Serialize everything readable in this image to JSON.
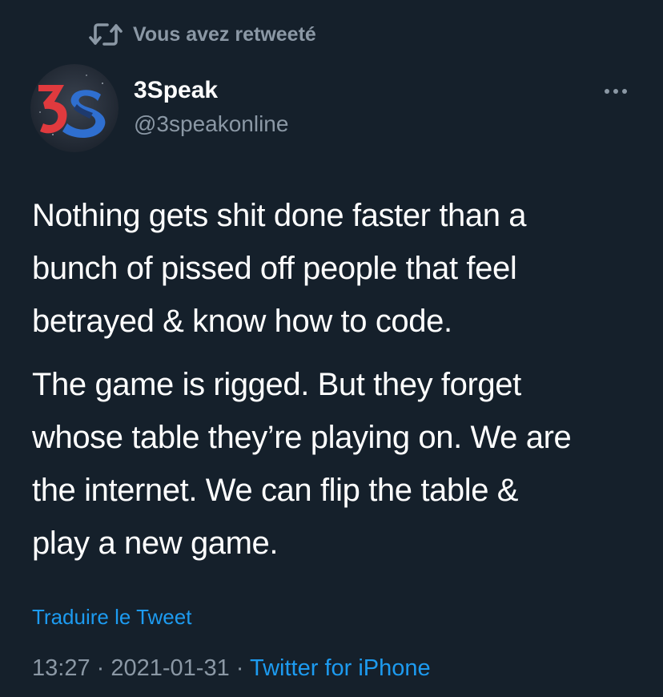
{
  "retweet": {
    "label": "Vous avez retweeté",
    "icon": "retweet-icon"
  },
  "author": {
    "display_name": "3Speak",
    "handle": "@3speakonline",
    "avatar_logo_text": "3S"
  },
  "tweet": {
    "paragraphs": [
      "Nothing gets shit done faster than a\nbunch of pissed off people that feel\nbetrayed & know how to code.",
      "The game is rigged. But they forget\nwhose table they’re playing on. We are\nthe internet. We can flip the table &\nplay a new game."
    ],
    "translate_label": "Traduire le Tweet",
    "time": "13:27",
    "date": "2021-01-31",
    "separator": "·",
    "source": "Twitter for iPhone"
  },
  "icons": {
    "more": "more-icon"
  },
  "colors": {
    "background": "#15202b",
    "text_primary": "#ffffff",
    "text_secondary": "#8b98a5",
    "link": "#1d9bf0",
    "logo_red": "#e03a3e",
    "logo_navy": "#1e3a6e",
    "logo_blue": "#2f6fd0"
  }
}
